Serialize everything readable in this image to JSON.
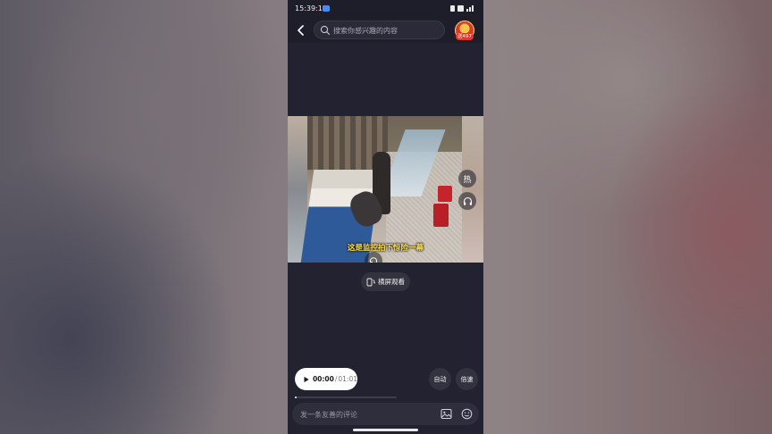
{
  "status_bar": {
    "time": "15:39:15"
  },
  "search": {
    "placeholder": "搜索你感兴趣的内容"
  },
  "avatar": {
    "badge": "送497"
  },
  "video": {
    "subtitle": "这是监控拍下惊险一幕",
    "side_button_1": "热"
  },
  "landscape_button": {
    "label": "横屏观看"
  },
  "player": {
    "current_time": "00:00",
    "separator": "/",
    "total_time": "01:01",
    "progress": 0.02,
    "auto_label": "自动",
    "speed_label": "倍速"
  },
  "comment": {
    "placeholder": "发一条友善的评论"
  },
  "colors": {
    "app_background": "#232230",
    "subtitle_yellow": "#ffe14a",
    "pill_white": "#ffffff"
  },
  "icons": [
    "back-icon",
    "search-icon",
    "headphone-icon",
    "replay-icon",
    "landscape-icon",
    "play-icon",
    "image-icon",
    "emoji-icon"
  ]
}
